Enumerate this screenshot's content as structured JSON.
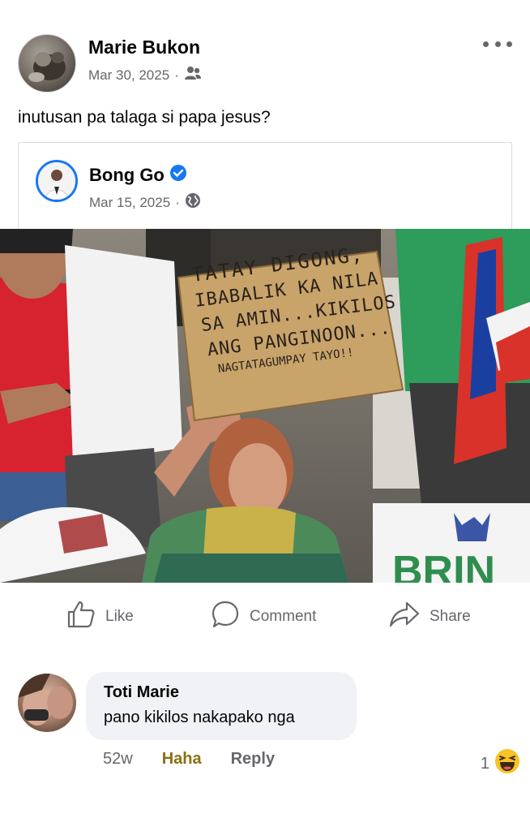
{
  "post": {
    "author": "Marie Bukon",
    "date": "Mar 30, 2025",
    "separator": "·",
    "audience_icon": "friends-icon",
    "text": "inutusan pa talaga si papa jesus?"
  },
  "shared": {
    "author": "Bong Go",
    "date": "Mar 15, 2025",
    "separator": "·",
    "audience_icon": "globe-icon",
    "verified_icon": "verified-badge-icon",
    "sign_lines": [
      "TATAY DIGONG,",
      "IBABALIK KA NILA",
      "SA AMIN...KIKILOS",
      "ANG PANGINOON...",
      "NAGTATAGUMPAY TAYO!!"
    ],
    "banner_text": "BRIN"
  },
  "actions": {
    "like": "Like",
    "comment": "Comment",
    "share": "Share"
  },
  "comment": {
    "author": "Toti Marie",
    "text": "pano kikilos nakapako nga",
    "time": "52w",
    "haha": "Haha",
    "reply": "Reply",
    "reaction_count": "1",
    "reaction_icon": "haha-emoji-icon"
  },
  "colors": {
    "accent": "#1877f2",
    "meta": "#65676b",
    "haha": "#8a7010"
  }
}
